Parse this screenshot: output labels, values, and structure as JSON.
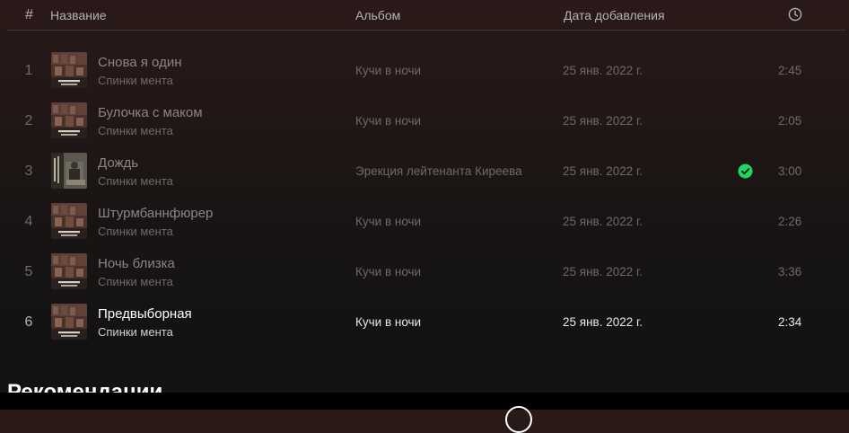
{
  "header": {
    "num_label": "#",
    "title_label": "Название",
    "album_label": "Альбом",
    "date_label": "Дата добавления",
    "duration_icon": "clock-icon"
  },
  "tracks": [
    {
      "num": "1",
      "title": "Снова я один",
      "artist": "Спинки мента",
      "album": "Кучи в ночи",
      "date": "25 янв. 2022 г.",
      "duration": "2:45",
      "cover": "kuchi-v-nochi-cover",
      "saved": false,
      "active": false
    },
    {
      "num": "2",
      "title": "Булочка с маком",
      "artist": "Спинки мента",
      "album": "Кучи в ночи",
      "date": "25 янв. 2022 г.",
      "duration": "2:05",
      "cover": "kuchi-v-nochi-cover",
      "saved": false,
      "active": false
    },
    {
      "num": "3",
      "title": "Дождь",
      "artist": "Спинки мента",
      "album": "Эрекция лейтенанта Киреева",
      "date": "25 янв. 2022 г.",
      "duration": "3:00",
      "cover": "erekciya-cover",
      "saved": true,
      "active": false
    },
    {
      "num": "4",
      "title": "Штурмбаннфюрер",
      "artist": "Спинки мента",
      "album": "Кучи в ночи",
      "date": "25 янв. 2022 г.",
      "duration": "2:26",
      "cover": "kuchi-v-nochi-cover",
      "saved": false,
      "active": false
    },
    {
      "num": "5",
      "title": "Ночь близка",
      "artist": "Спинки мента",
      "album": "Кучи в ночи",
      "date": "25 янв. 2022 г.",
      "duration": "3:36",
      "cover": "kuchi-v-nochi-cover",
      "saved": false,
      "active": false
    },
    {
      "num": "6",
      "title": "Предвыборная",
      "artist": "Спинки мента",
      "album": "Кучи в ночи",
      "date": "25 янв. 2022 г.",
      "duration": "2:34",
      "cover": "kuchi-v-nochi-cover",
      "saved": false,
      "active": true
    }
  ],
  "recommendations": {
    "title": "Рекомендации"
  },
  "colors": {
    "saved_green": "#1ed760",
    "background_top": "#2a1a19",
    "background_bottom": "#121212"
  }
}
